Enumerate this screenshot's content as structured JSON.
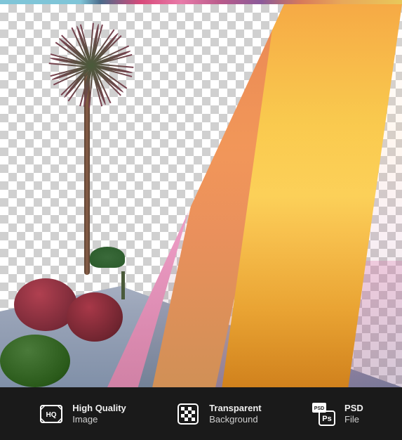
{
  "badges": [
    {
      "icon": "hq-icon",
      "line1": "High Quality",
      "line2": "Image"
    },
    {
      "icon": "transparency-icon",
      "line1": "Transparent",
      "line2": "Background"
    },
    {
      "icon": "psd-icon",
      "psd_label": "PSD",
      "ps_label": "Ps",
      "line1": "PSD",
      "line2": "File"
    }
  ],
  "image": {
    "description": "Colorful modern glass building with palm tree and bushes on transparent background",
    "elements": {
      "palm_tree": "tall",
      "small_palm": "short",
      "bushes": [
        "red",
        "red",
        "green"
      ],
      "building_panels": [
        "yellow",
        "orange",
        "pink",
        "purple",
        "teal"
      ],
      "floor": "reflective tile"
    }
  },
  "colors": {
    "bar_bg": "#1a1a1a",
    "text_primary": "#f0f0f0",
    "text_secondary": "#d0d0d0"
  }
}
